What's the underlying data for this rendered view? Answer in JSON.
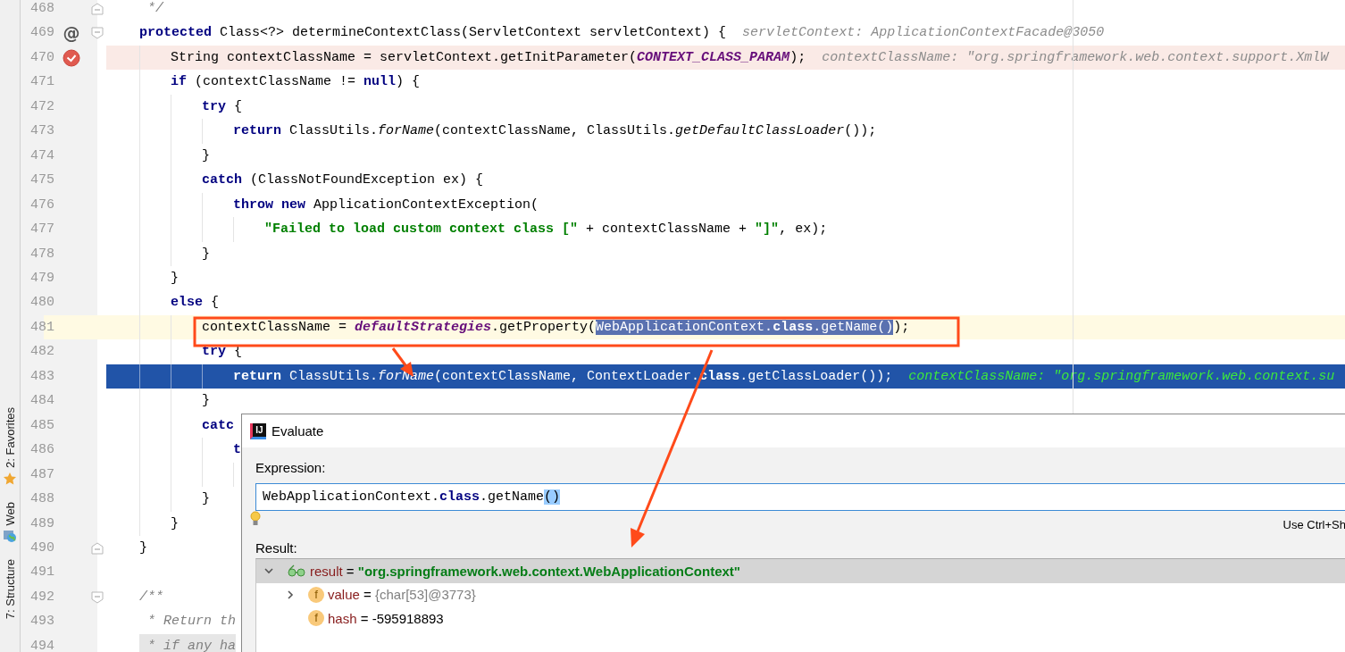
{
  "tool_strip": [
    {
      "label": "2: Favorites"
    },
    {
      "label": "Web"
    },
    {
      "label": "7: Structure"
    }
  ],
  "lines": [
    {
      "number": "468",
      "fold_end": true,
      "tokens": [
        {
          "t": " */",
          "kind": "comment"
        }
      ]
    },
    {
      "number": "469",
      "fold_start": true,
      "gutter": "@",
      "tokens": [
        {
          "t": "protected",
          "kind": "keyword"
        },
        {
          "t": " Class<?> determineContextClass(ServletContext servletContext) {",
          "kind": "plain"
        },
        {
          "t": "servletContext: ApplicationContextFacade@3050",
          "kind": "hint"
        }
      ],
      "children": [
        {
          "number": "470",
          "breakpoint": true,
          "tokens": [
            {
              "t": "String contextClassName = servletContext.getInitParameter(",
              "kind": "plain"
            },
            {
              "t": "CONTEXT_CLASS_PARAM",
              "kind": "constant"
            },
            {
              "t": ");",
              "kind": "plain"
            },
            {
              "t": "contextClassName: \"org.springframework.web.context.support.XmlW",
              "kind": "hint"
            }
          ]
        },
        {
          "number": "471",
          "tokens": [
            {
              "t": "if",
              "kind": "keyword"
            },
            {
              "t": " (contextClassName != ",
              "kind": "plain"
            },
            {
              "t": "null",
              "kind": "keyword"
            },
            {
              "t": ") {",
              "kind": "plain"
            }
          ],
          "children": [
            {
              "number": "472",
              "tokens": [
                {
                  "t": "try",
                  "kind": "keyword"
                },
                {
                  "t": " {",
                  "kind": "plain"
                }
              ],
              "children": [
                {
                  "number": "473",
                  "tokens": [
                    {
                      "t": "return",
                      "kind": "keyword"
                    },
                    {
                      "t": " ClassUtils.",
                      "kind": "plain"
                    },
                    {
                      "t": "forName",
                      "kind": "italic"
                    },
                    {
                      "t": "(contextClassName, ClassUtils.",
                      "kind": "plain"
                    },
                    {
                      "t": "getDefaultClassLoader",
                      "kind": "italic"
                    },
                    {
                      "t": "());",
                      "kind": "plain"
                    }
                  ]
                }
              ]
            },
            {
              "number": "474",
              "tokens": [
                {
                  "t": "}",
                  "kind": "plain"
                }
              ]
            },
            {
              "number": "475",
              "tokens": [
                {
                  "t": "catch",
                  "kind": "keyword"
                },
                {
                  "t": " (ClassNotFoundException ex) {",
                  "kind": "plain"
                }
              ],
              "children": [
                {
                  "number": "476",
                  "tokens": [
                    {
                      "t": "throw",
                      "kind": "keyword"
                    },
                    {
                      "t": " new",
                      "kind": "keyword"
                    },
                    {
                      "t": " ApplicationContextException(",
                      "kind": "plain"
                    }
                  ],
                  "children": [
                    {
                      "number": "477",
                      "tokens": [
                        {
                          "t": "\"Failed to load custom context class [\"",
                          "kind": "string"
                        },
                        {
                          "t": " + contextClassName + ",
                          "kind": "plain"
                        },
                        {
                          "t": "\"]\"",
                          "kind": "string"
                        },
                        {
                          "t": ", ex);",
                          "kind": "plain"
                        }
                      ]
                    }
                  ]
                }
              ]
            },
            {
              "number": "478",
              "tokens": [
                {
                  "t": "}",
                  "kind": "plain"
                }
              ]
            }
          ]
        },
        {
          "number": "479",
          "tokens": [
            {
              "t": "}",
              "kind": "plain"
            }
          ]
        },
        {
          "number": "480",
          "tokens": [
            {
              "t": "else",
              "kind": "keyword"
            },
            {
              "t": " {",
              "kind": "plain"
            }
          ],
          "children": [
            {
              "number": "481",
              "caret": true,
              "tokens": [
                {
                  "t": "contextClassName = ",
                  "kind": "plain"
                },
                {
                  "t": "defaultStrategies",
                  "kind": "constant"
                },
                {
                  "t": ".getProperty(",
                  "kind": "plain"
                },
                {
                  "t": "WebApplicationContext.",
                  "kind": "selected_plain"
                },
                {
                  "t": "class",
                  "kind": "selected_keyword"
                },
                {
                  "t": ".getName()",
                  "kind": "selected_plain"
                },
                {
                  "t": ");",
                  "kind": "plain"
                }
              ]
            },
            {
              "number": "482",
              "tokens": [
                {
                  "t": "try",
                  "kind": "keyword"
                },
                {
                  "t": " {",
                  "kind": "plain"
                }
              ],
              "children": [
                {
                  "number": "483",
                  "executing": true,
                  "tokens": [
                    {
                      "t": "return",
                      "kind": "keyword"
                    },
                    {
                      "t": " ClassUtils.",
                      "kind": "plain"
                    },
                    {
                      "t": "forName",
                      "kind": "italic"
                    },
                    {
                      "t": "(contextClassName, ContextLoader.",
                      "kind": "plain"
                    },
                    {
                      "t": "class",
                      "kind": "keyword"
                    },
                    {
                      "t": ".getClassLoader());",
                      "kind": "plain"
                    },
                    {
                      "t": "contextClassName: \"org.springframework.web.context.su",
                      "kind": "hint"
                    }
                  ]
                }
              ]
            },
            {
              "number": "484",
              "tokens": [
                {
                  "t": "}",
                  "kind": "plain"
                }
              ]
            },
            {
              "number": "485",
              "tokens": [
                {
                  "t": "catc",
                  "kind": "keyword"
                }
              ],
              "children": [
                {
                  "number": "486",
                  "tokens": [
                    {
                      "t": "t",
                      "kind": "keyword"
                    }
                  ],
                  "children": [
                    {
                      "number": "487"
                    }
                  ]
                }
              ]
            },
            {
              "number": "488",
              "tokens": [
                {
                  "t": "}",
                  "kind": "plain"
                }
              ]
            }
          ]
        },
        {
          "number": "489",
          "tokens": [
            {
              "t": "}",
              "kind": "plain"
            }
          ]
        }
      ]
    },
    {
      "number": "490",
      "fold_end": true,
      "tokens": [
        {
          "t": "}",
          "kind": "plain"
        }
      ]
    },
    {
      "number": "491"
    },
    {
      "number": "492",
      "fold_start": true,
      "tokens": [
        {
          "t": "/**",
          "kind": "comment"
        }
      ]
    },
    {
      "number": "493",
      "tokens": [
        {
          "t": " * Return th",
          "kind": "comment"
        }
      ]
    },
    {
      "number": "494",
      "folded": true,
      "tokens": [
        {
          "t": " * if any ha",
          "kind": "comment"
        }
      ]
    }
  ],
  "dialog": {
    "logo": "IJ",
    "title": "Evaluate",
    "expression_label": "Expression:",
    "expression": [
      {
        "t": "WebApplicationContext.",
        "kind": "plain"
      },
      {
        "t": "class",
        "kind": "keyword"
      },
      {
        "t": ".getName",
        "kind": "plain"
      },
      {
        "t": "()",
        "kind": "match"
      }
    ],
    "shortcut_hint": "Use Ctrl+Sh",
    "result_label": "Result:",
    "tree": [
      {
        "name": "result",
        "operator": "=",
        "value": "\"org.springframework.web.context.WebApplicationContext\"",
        "kind": "string",
        "selected": true,
        "expanded": true,
        "children": [
          {
            "name": "value",
            "operator": "=",
            "value": "{char[53]@3773}",
            "kind": "reference",
            "icon_letter": "f",
            "selected": false,
            "expanded": false
          },
          {
            "name": "hash",
            "operator": "=",
            "value": "-595918893",
            "kind": "number",
            "icon_letter": "f",
            "selected": false
          }
        ]
      }
    ]
  }
}
